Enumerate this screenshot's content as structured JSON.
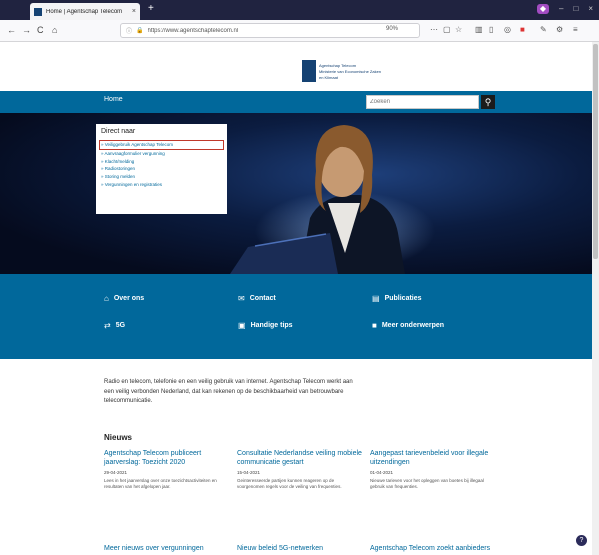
{
  "browser": {
    "tab_title": "Home | Agentschap Telecom",
    "tab_close": "×",
    "new_tab": "+",
    "window_controls": [
      "–",
      "□",
      "×"
    ],
    "nav_buttons": {
      "back": "←",
      "forward": "→",
      "reload": "C",
      "home": "⌂"
    },
    "url": "https://www.agentschaptelecom.nl",
    "zoom": "90%",
    "toolbar_icons": [
      "more-icon",
      "pocket-icon",
      "star-icon",
      "library-icon",
      "sidebar-icon",
      "account-icon",
      "extension-icon",
      "puzzle-icon",
      "menu-icon"
    ]
  },
  "header": {
    "logo_lines": [
      "Agentschap Telecom",
      "Ministerie van Economische Zaken",
      "en Klimaat"
    ]
  },
  "menu": {
    "home": "Home",
    "search_placeholder": "Zoeken",
    "search_icon": "search-icon"
  },
  "direct": {
    "title": "Direct naar",
    "items": [
      "Veiliggebruik Agentschap Telecom",
      "Aanvraagformulier vergunning",
      "Klacht/melding",
      "Radiostoringen",
      "Storing melden",
      "Vergunningen en registraties"
    ]
  },
  "band": {
    "links": [
      {
        "label": "Over ons",
        "icon": "home-icon"
      },
      {
        "label": "Contact",
        "icon": "chat-icon"
      },
      {
        "label": "Publicaties",
        "icon": "publications-icon"
      },
      {
        "label": "5G",
        "icon": "signal-icon"
      },
      {
        "label": "Handige tips",
        "icon": "tips-icon"
      },
      {
        "label": "Meer onderwerpen",
        "icon": "topics-icon"
      }
    ]
  },
  "intro": {
    "text": "Radio en telecom, telefonie en een veilig gebruik van internet. Agentschap Telecom werkt aan een veilig verbonden Nederland, dat kan rekenen op de beschikbaarheid van betrouwbare telecommunicatie."
  },
  "news": {
    "heading": "Nieuws",
    "items": [
      {
        "title": "Agentschap Telecom publiceert jaarverslag: Toezicht 2020",
        "date": "29-04-2021",
        "desc": "Lees in het jaarverslag over onze toezichtsactiviteiten en resultaten van het afgelopen jaar."
      },
      {
        "title": "Consultatie Nederlandse veiling mobiele communicatie gestart",
        "date": "15-04-2021",
        "desc": "Geinteresseerde partijen kunnen reageren op de voorgenomen regels voor de veiling van frequenties."
      },
      {
        "title": "Aangepast tarievenbeleid voor illegale uitzendingen",
        "date": "01-04-2021",
        "desc": "Nieuwe tarieven voor het opleggen van boetes bij illegaal gebruik van frequenties."
      }
    ],
    "row2": [
      "Meer nieuws over vergunningen",
      "Nieuw beleid 5G-netwerken",
      "Agentschap Telecom zoekt aanbieders"
    ]
  },
  "help": "?"
}
